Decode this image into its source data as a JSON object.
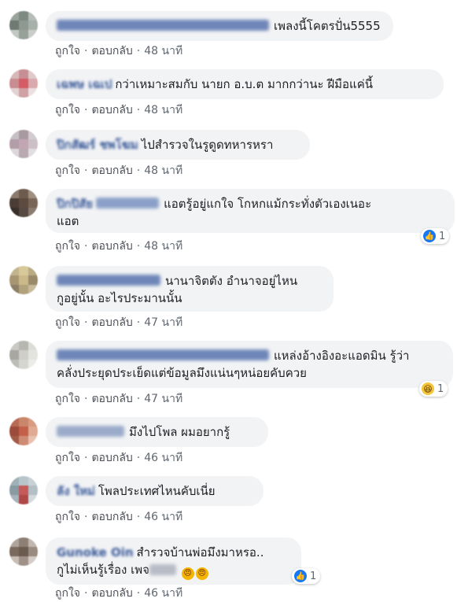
{
  "colors": {
    "bubble": "#f2f3f5",
    "name": "#385898",
    "meta": "#606770",
    "like": "#1877f2"
  },
  "actions": {
    "like": "ถูกใจ",
    "reply": "ตอบกลับ",
    "sep": "·"
  },
  "comments": [
    {
      "name": "",
      "text": "เพลงนี้โคตรปั่น5555",
      "time": "48 นาที"
    },
    {
      "name": "เฉพษ เฉเป",
      "text": "กว่าเหมาะสมกับ นายก อ.บ.ต มากกว่านะ ฝีมือแค่นี้",
      "time": "48 นาที"
    },
    {
      "name": "ปิกสัฒร์ ชพโฆม",
      "text": "ไปสำรวจในรูดูดทหารหรา",
      "time": "48 นาที"
    },
    {
      "name": "ปิกปิสัย",
      "text": "แอตรู้อยู่แกใจ โกหกแม้กระทั่งตัวเองเนอะ",
      "text2": "แอต",
      "time": "48 นาที",
      "reaction": "1"
    },
    {
      "name": "",
      "text": "นานาจิตตัง อำนาจอยู่ไหน",
      "text2": "กูอยู่นั้น อะไรประมานนั้น",
      "time": "47 นาที"
    },
    {
      "name": "",
      "text": "แหล่งอ้างอิงอะแอดมิน รู้ว่า",
      "text2": "คลั่งประยุดประเย็ดแต่ข้อมูลมึงแน่นๆหน่อยคับควย",
      "time": "47 นาที",
      "reaction": "1"
    },
    {
      "name": "",
      "text": "มึงไปโพล ผมอยากรู้",
      "time": "46 นาที"
    },
    {
      "name": "ลัง ใหม่",
      "text": "โพลประเทศไหนคับเนี่ย",
      "time": "46 นาที"
    },
    {
      "name": "Gunoke Oin",
      "text": "สำรวจบ้านพ่อมึงมาหรอ..",
      "text2": "กูไม่เห็นรู้เรื่อง เพจ",
      "time": "46 นาที",
      "reaction": "1"
    }
  ]
}
